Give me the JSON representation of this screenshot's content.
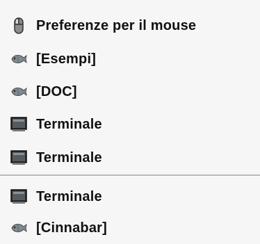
{
  "menu": {
    "items": [
      {
        "label": "Preferenze per il mouse",
        "icon": "mouse-icon"
      },
      {
        "label": "[Esempi]",
        "icon": "fish-icon"
      },
      {
        "label": "[DOC]",
        "icon": "fish-icon"
      },
      {
        "label": "Terminale",
        "icon": "terminal-icon"
      },
      {
        "label": "Terminale",
        "icon": "terminal-icon"
      },
      {
        "label": "Terminale",
        "icon": "terminal-icon"
      },
      {
        "label": "[Cinnabar]",
        "icon": "fish-icon"
      }
    ]
  }
}
